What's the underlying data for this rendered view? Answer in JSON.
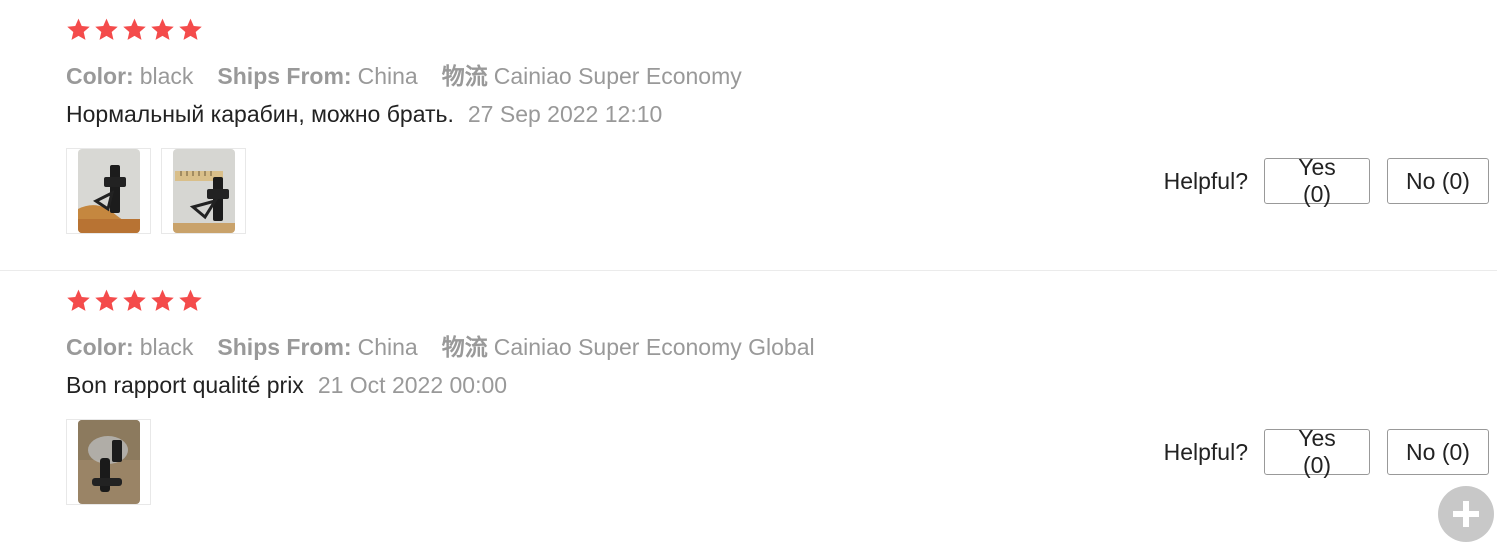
{
  "colors": {
    "star": "#f44b4b",
    "muted": "#999999",
    "text": "#222222"
  },
  "reviews": [
    {
      "rating": 5,
      "color_label": "Color:",
      "color_value": "black",
      "ships_label": "Ships From:",
      "ships_value": "China",
      "logistics_label": "物流",
      "logistics_value": "Cainiao Super Economy",
      "text": "Нормальный карабин, можно брать.",
      "date": "27 Sep 2022 12:10",
      "photos": [
        "carabiner-photo-1",
        "carabiner-photo-2"
      ],
      "helpful_label": "Helpful?",
      "yes_label": "Yes (0)",
      "no_label": "No (0)"
    },
    {
      "rating": 5,
      "color_label": "Color:",
      "color_value": "black",
      "ships_label": "Ships From:",
      "ships_value": "China",
      "logistics_label": "物流",
      "logistics_value": "Cainiao Super Economy Global",
      "text": "Bon rapport qualité prix",
      "date": "21 Oct 2022 00:00",
      "photos": [
        "carabiner-photo-3"
      ],
      "helpful_label": "Helpful?",
      "yes_label": "Yes (0)",
      "no_label": "No (0)"
    }
  ],
  "fab_icon": "plus-icon"
}
